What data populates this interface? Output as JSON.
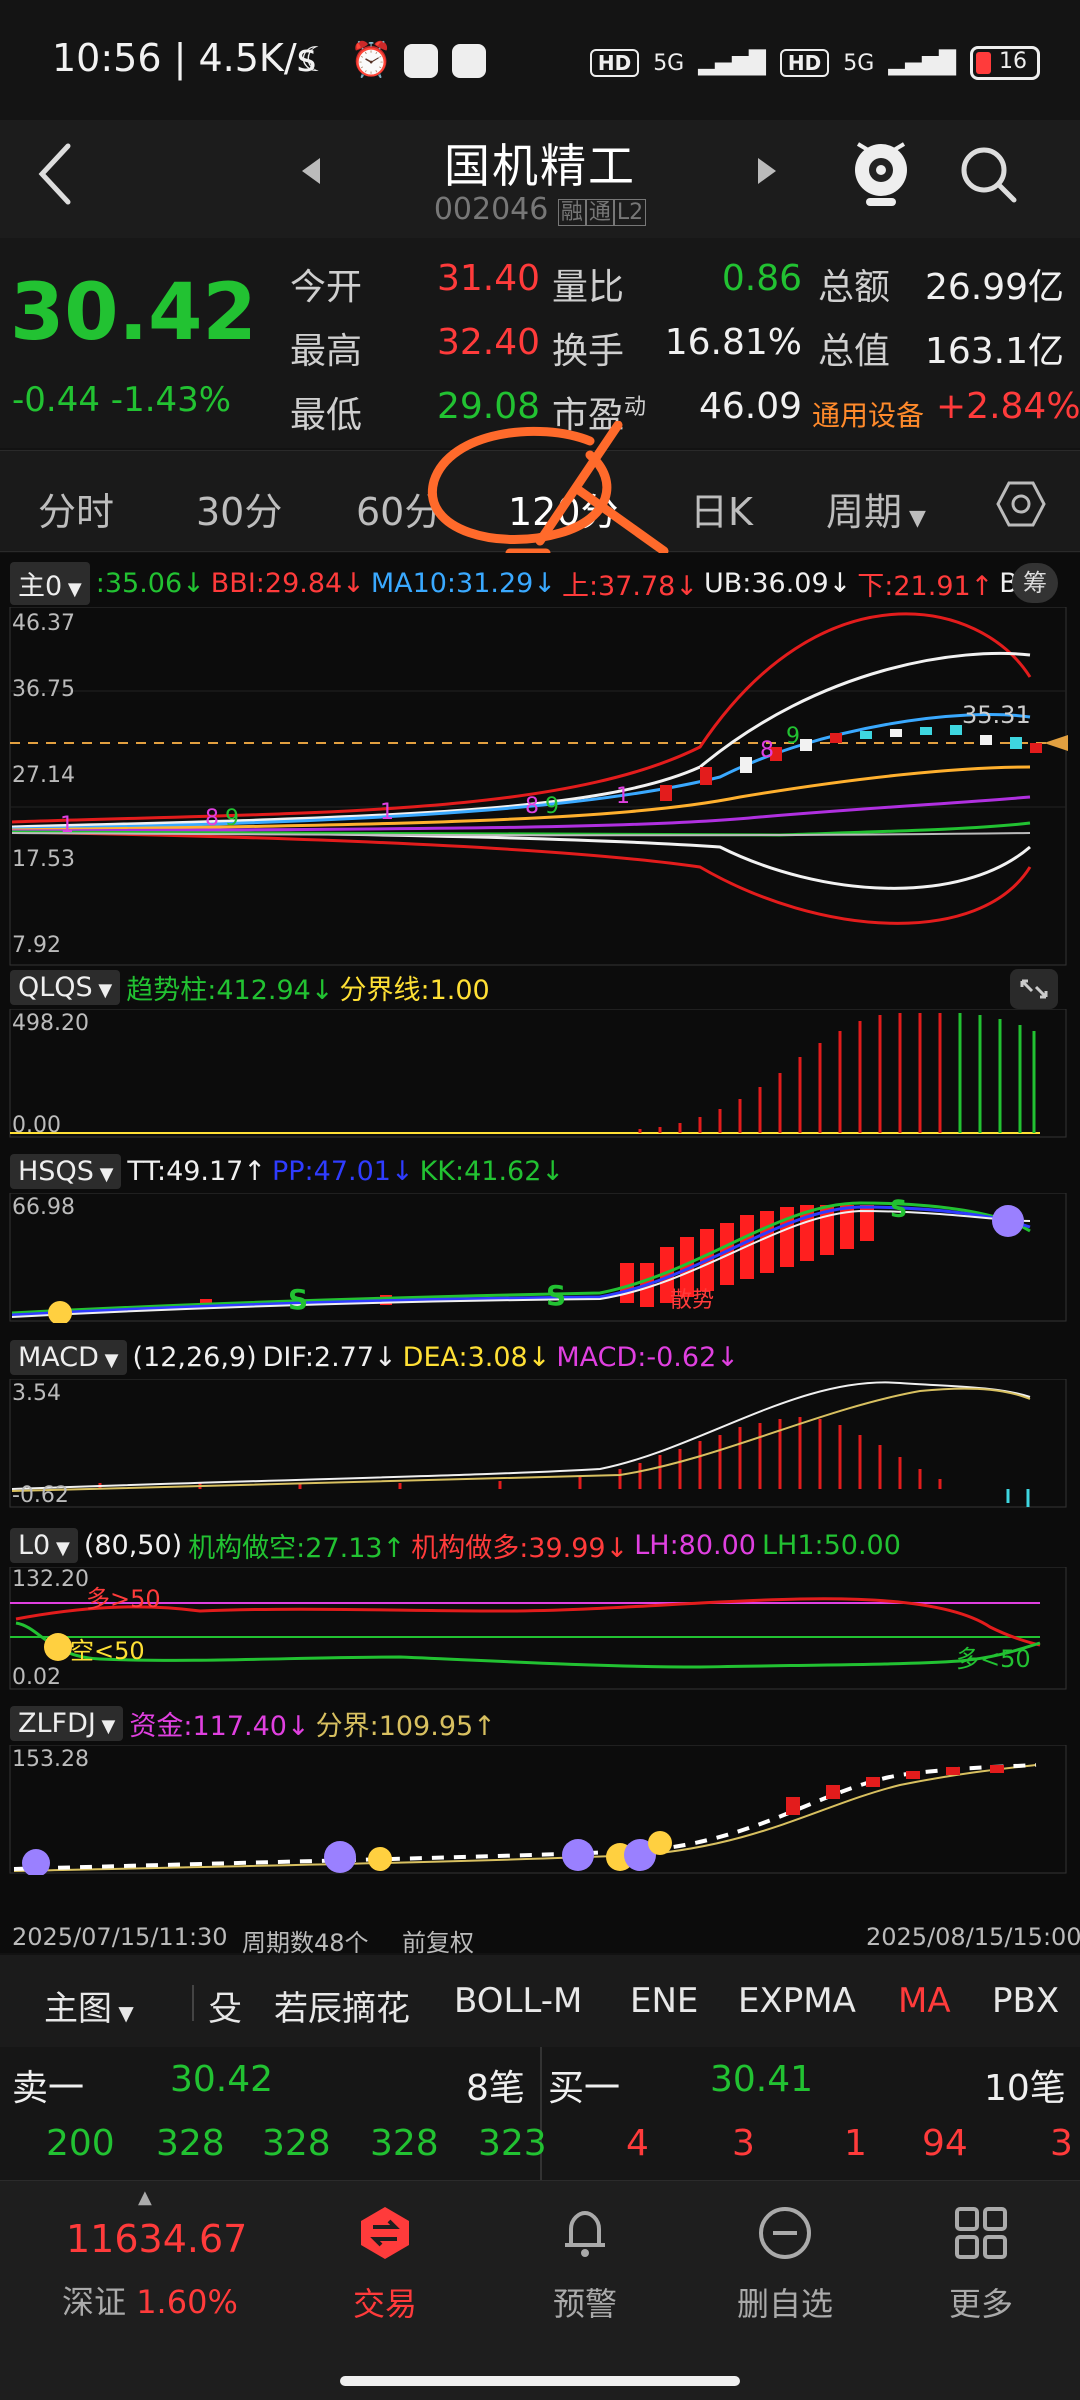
{
  "status_bar": {
    "time": "10:56 | 4.5K/s",
    "net1": "HD",
    "net2": "5G",
    "net3": "HD",
    "net4": "5G",
    "battery": "16"
  },
  "header": {
    "title": "国机精工",
    "code": "002046",
    "tag1": "融",
    "tag2": "通",
    "tag3": "L2"
  },
  "quote": {
    "price": "30.42",
    "change": "-0.44",
    "change_pct": "-1.43%",
    "open_label": "今开",
    "open": "31.40",
    "high_label": "最高",
    "high": "32.40",
    "low_label": "最低",
    "low": "29.08",
    "vol_ratio_label": "量比",
    "vol_ratio": "0.86",
    "turnover_label": "换手",
    "turnover": "16.81%",
    "pe_label": "市盈",
    "pe_sup": "动",
    "pe": "46.09",
    "amount_label": "总额",
    "amount": "26.99亿",
    "mktcap_label": "总值",
    "mktcap": "163.1亿",
    "sector_label": "通用设备",
    "sector_pct": "+2.84%"
  },
  "tabs": [
    "分时",
    "30分",
    "60分",
    "120分",
    "日K",
    "周期"
  ],
  "main_indicator": {
    "selector": "主0",
    "v0": ":35.06↓",
    "bbi": "BBI:29.84↓",
    "ma10": "MA10:31.29↓",
    "up": "上:37.78↓",
    "ub": "UB:36.09↓",
    "down": "下:21.91↑",
    "tail": "B",
    "chip": "筹",
    "axis": [
      "46.37",
      "36.75",
      "27.14",
      "17.53",
      "7.92"
    ],
    "last_label": "35.31"
  },
  "qlqs": {
    "selector": "QLQS",
    "trend": "趋势柱:412.94↓",
    "divide": "分界线:1.00",
    "axis": [
      "498.20",
      "0.00"
    ]
  },
  "hsqs": {
    "selector": "HSQS",
    "tt": "TT:49.17↑",
    "pp": "PP:47.01↓",
    "kk": "KK:41.62↓",
    "axis": [
      "66.98"
    ],
    "note": "散势"
  },
  "macd": {
    "selector": "MACD",
    "params": "(12,26,9)",
    "dif": "DIF:2.77↓",
    "dea": "DEA:3.08↓",
    "macd": "MACD:-0.62↓",
    "axis": [
      "3.54",
      "-0.62"
    ]
  },
  "l0": {
    "selector": "L0",
    "params": "(80,50)",
    "short": "机构做空:27.13↑",
    "long": "机构做多:39.99↓",
    "lh": "LH:80.00",
    "lh1": "LH1:50.00",
    "axis": [
      "132.20",
      "0.02"
    ],
    "ann1": "多>50",
    "ann2": "空<50",
    "ann3": "多<50"
  },
  "zlfdj": {
    "selector": "ZLFDJ",
    "fund": "资金:117.40↓",
    "divide": "分界:109.95↑",
    "axis": [
      "153.28"
    ]
  },
  "footer_range": {
    "start": "2025/07/15/11:30",
    "periods": "周期数48个",
    "adjust": "前复权",
    "end": "2025/08/15/15:00"
  },
  "indicator_tabs": [
    "主图",
    "殳",
    "若辰摘花",
    "BOLL-M",
    "ENE",
    "EXPMA",
    "MA",
    "PBX"
  ],
  "order_book": {
    "sell_label": "卖一",
    "sell_price": "30.42",
    "sell_count": "8笔",
    "buy_label": "买一",
    "buy_price": "30.41",
    "buy_count": "10笔",
    "sell_vols": [
      "200",
      "328",
      "328",
      "328",
      "323"
    ],
    "buy_vols": [
      "4",
      "3",
      "1",
      "94",
      "3"
    ]
  },
  "bottom_nav": {
    "index_value": "11634.67",
    "index_name": "深证",
    "index_pct": "1.60%",
    "items": [
      "交易",
      "预警",
      "删自选",
      "更多"
    ]
  },
  "colors": {
    "up": "#ff3b3b",
    "down": "#22c232",
    "accent_orange": "#ff6a2b"
  }
}
